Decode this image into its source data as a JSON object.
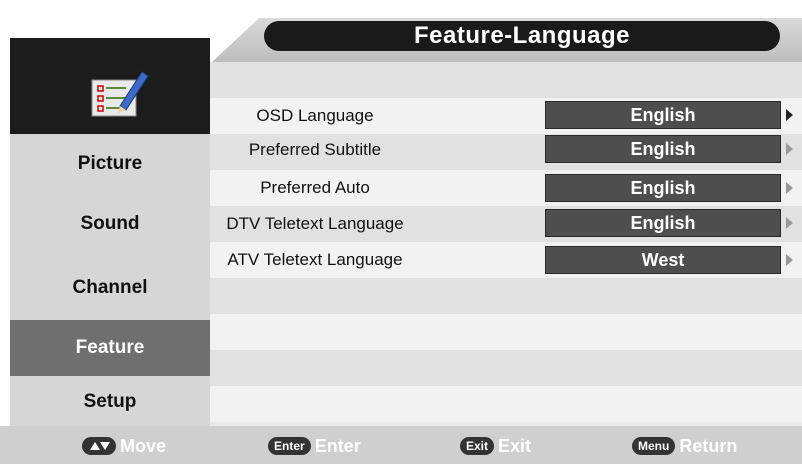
{
  "title": "Feature-Language",
  "sidebar": {
    "items": [
      {
        "label": "Picture",
        "active": false
      },
      {
        "label": "Sound",
        "active": false
      },
      {
        "label": "Channel",
        "active": false
      },
      {
        "label": "Feature",
        "active": true
      },
      {
        "label": "Setup",
        "active": false
      }
    ],
    "icon": "checklist-pencil-icon"
  },
  "settings": [
    {
      "label": "OSD Language",
      "value": "English",
      "selected": true
    },
    {
      "label": "Preferred Subtitle",
      "value": "English",
      "selected": false
    },
    {
      "label": "Preferred  Auto",
      "value": "English",
      "selected": false
    },
    {
      "label": "DTV Teletext Language",
      "value": "English",
      "selected": false
    },
    {
      "label": "ATV Teletext Language",
      "value": "West",
      "selected": false
    }
  ],
  "footer": {
    "move": {
      "key": "updown-key-icon",
      "label": "Move"
    },
    "enter": {
      "key": "Enter",
      "label": "Enter"
    },
    "exit": {
      "key": "Exit",
      "label": "Exit"
    },
    "menu": {
      "key": "Menu",
      "label": "Return"
    }
  },
  "colors": {
    "title_bg": "#1a1a1a",
    "active_item": "#6f6f6f",
    "value_box": "#4e4e4e",
    "footer_bg": "#cfcfcf"
  }
}
